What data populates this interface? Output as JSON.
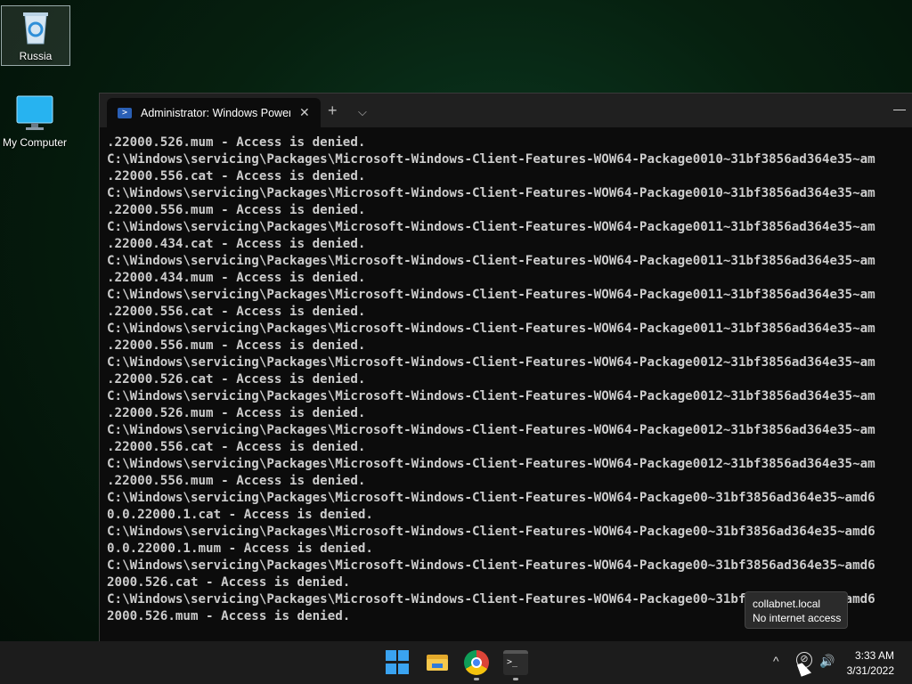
{
  "desktop": {
    "icons": [
      {
        "label": "Russia",
        "icon": "recycle-bin-icon"
      },
      {
        "label": "My Computer",
        "icon": "monitor-icon"
      }
    ]
  },
  "terminal": {
    "tab_title": "Administrator: Windows PowerS",
    "tab_close": "✕",
    "new_tab": "+",
    "dropdown": "⌵",
    "minimize": "—",
    "lines": [
      ".22000.526.mum - Access is denied.",
      "C:\\Windows\\servicing\\Packages\\Microsoft-Windows-Client-Features-WOW64-Package0010~31bf3856ad364e35~am",
      ".22000.556.cat - Access is denied.",
      "C:\\Windows\\servicing\\Packages\\Microsoft-Windows-Client-Features-WOW64-Package0010~31bf3856ad364e35~am",
      ".22000.556.mum - Access is denied.",
      "C:\\Windows\\servicing\\Packages\\Microsoft-Windows-Client-Features-WOW64-Package0011~31bf3856ad364e35~am",
      ".22000.434.cat - Access is denied.",
      "C:\\Windows\\servicing\\Packages\\Microsoft-Windows-Client-Features-WOW64-Package0011~31bf3856ad364e35~am",
      ".22000.434.mum - Access is denied.",
      "C:\\Windows\\servicing\\Packages\\Microsoft-Windows-Client-Features-WOW64-Package0011~31bf3856ad364e35~am",
      ".22000.556.cat - Access is denied.",
      "C:\\Windows\\servicing\\Packages\\Microsoft-Windows-Client-Features-WOW64-Package0011~31bf3856ad364e35~am",
      ".22000.556.mum - Access is denied.",
      "C:\\Windows\\servicing\\Packages\\Microsoft-Windows-Client-Features-WOW64-Package0012~31bf3856ad364e35~am",
      ".22000.526.cat - Access is denied.",
      "C:\\Windows\\servicing\\Packages\\Microsoft-Windows-Client-Features-WOW64-Package0012~31bf3856ad364e35~am",
      ".22000.526.mum - Access is denied.",
      "C:\\Windows\\servicing\\Packages\\Microsoft-Windows-Client-Features-WOW64-Package0012~31bf3856ad364e35~am",
      ".22000.556.cat - Access is denied.",
      "C:\\Windows\\servicing\\Packages\\Microsoft-Windows-Client-Features-WOW64-Package0012~31bf3856ad364e35~am",
      ".22000.556.mum - Access is denied.",
      "C:\\Windows\\servicing\\Packages\\Microsoft-Windows-Client-Features-WOW64-Package00~31bf3856ad364e35~amd6",
      "0.0.22000.1.cat - Access is denied.",
      "C:\\Windows\\servicing\\Packages\\Microsoft-Windows-Client-Features-WOW64-Package00~31bf3856ad364e35~amd6",
      "0.0.22000.1.mum - Access is denied.",
      "C:\\Windows\\servicing\\Packages\\Microsoft-Windows-Client-Features-WOW64-Package00~31bf3856ad364e35~amd6",
      "2000.526.cat - Access is denied.",
      "C:\\Windows\\servicing\\Packages\\Microsoft-Windows-Client-Features-WOW64-Package00~31bf3856ad364e35~amd6",
      "2000.526.mum - Access is denied."
    ]
  },
  "tooltip": {
    "line1": "collabnet.local",
    "line2": "No internet access"
  },
  "taskbar": {
    "apps": [
      "start-icon",
      "file-explorer-icon",
      "chrome-icon",
      "terminal-icon"
    ],
    "terminal_glyph": ">_",
    "tray_chevron": "^",
    "network_glyph": "⊘",
    "volume_glyph": "🔊",
    "time": "3:33 AM",
    "date": "3/31/2022"
  },
  "colors": {
    "accent": "#3aa3f0",
    "console_text": "#cccccc",
    "console_bg": "#0c0c0c"
  }
}
